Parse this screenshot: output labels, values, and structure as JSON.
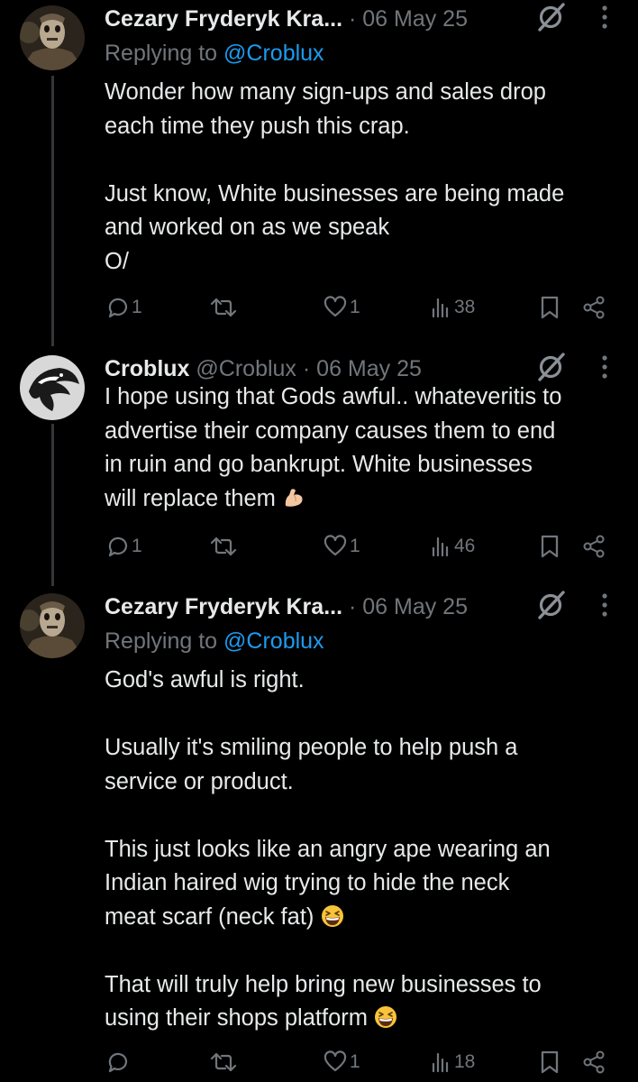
{
  "tweets": [
    {
      "author_name": "Cezary Fryderyk Kra...",
      "handle": "",
      "date": "· 06 May 25",
      "replying_prefix": "Replying to",
      "replying_handle": "@Croblux",
      "body": "Wonder how many sign-ups and sales drop\neach time they push this crap.\n\nJust know, White businesses are being made\nand worked on as we speak\nO/",
      "replies": "1",
      "reposts": "",
      "likes": "1",
      "views": "38"
    },
    {
      "author_name": "Croblux",
      "handle": "@Croblux",
      "date": "· 06 May 25",
      "body": "I hope using that Gods awful.. whateveritis to\nadvertise their company causes them to end\nin ruin and go bankrupt. White businesses\nwill replace them",
      "body_emoji": "flexed-biceps",
      "replies": "1",
      "reposts": "",
      "likes": "1",
      "views": "46"
    },
    {
      "author_name": "Cezary Fryderyk Kra...",
      "handle": "",
      "date": "· 06 May 25",
      "replying_prefix": "Replying to",
      "replying_handle": "@Croblux",
      "body_part1": "God's awful is right.\n\nUsually it's smiling people to help push a\nservice or product.\n\nThis just looks like an angry ape wearing an\nIndian haired wig trying to hide the neck\nmeat scarf (neck fat)",
      "body_part2": "\n\nThat will truly help bring new businesses to\nusing their shops platform",
      "body_emoji": "grinning-squinting-face",
      "replies": "",
      "reposts": "",
      "likes": "1",
      "views": "18"
    }
  ],
  "colors": {
    "background": "#000000",
    "text": "#e7e9ea",
    "muted": "#71767b",
    "link": "#1d9bf0",
    "thread_line": "#333639"
  }
}
